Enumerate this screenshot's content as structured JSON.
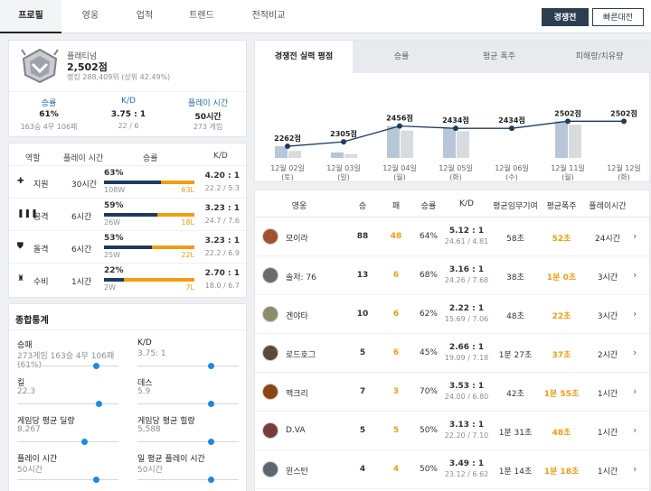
{
  "nav": {
    "tabs": [
      "프로필",
      "영웅",
      "업적",
      "트렌드",
      "전적비교"
    ],
    "modes": [
      "경쟁전",
      "빠른대전"
    ]
  },
  "tier": {
    "name": "플래티넘",
    "score": "2,502점",
    "rank": "랭킹 288,409위 (상위 42.49%)"
  },
  "summary": {
    "winrate_label": "승률",
    "winrate": "61%",
    "winrate_sub": "163승 4무 106패",
    "kd_label": "K/D",
    "kd": "3.75 : 1",
    "kd_sub": "22 / 6",
    "time_label": "플레이 시간",
    "time": "50시간",
    "time_sub": "273 게임"
  },
  "roles": {
    "headers": [
      "역할",
      "플레이 시간",
      "승률",
      "K/D"
    ],
    "rows": [
      {
        "icon": "plus-icon",
        "name": "지원",
        "time": "30시간",
        "pct": "63%",
        "w": "108W",
        "l": "63L",
        "win_frac": 0.63,
        "kd": "4.20 : 1",
        "kd_sub": "22.2 / 5.3"
      },
      {
        "icon": "damage-icon",
        "name": "공격",
        "time": "6시간",
        "pct": "59%",
        "w": "26W",
        "l": "18L",
        "win_frac": 0.59,
        "kd": "3.23 : 1",
        "kd_sub": "24.7 / 7.6"
      },
      {
        "icon": "shield-icon",
        "name": "돌격",
        "time": "6시간",
        "pct": "53%",
        "w": "25W",
        "l": "22L",
        "win_frac": 0.53,
        "kd": "3.23 : 1",
        "kd_sub": "22.2 / 6.9"
      },
      {
        "icon": "castle-icon",
        "name": "수비",
        "time": "1시간",
        "pct": "22%",
        "w": "2W",
        "l": "7L",
        "win_frac": 0.22,
        "kd": "2.70 : 1",
        "kd_sub": "18.0 / 6.7"
      }
    ]
  },
  "overall": {
    "title": "종합통계",
    "stats": [
      {
        "label": "승패",
        "value": "273게임 163승 4무 106패 (61%)",
        "level": 0.78
      },
      {
        "label": "K/D",
        "value": "3.75: 1",
        "level": 0.72
      },
      {
        "label": "킬",
        "value": "22.3",
        "level": 0.8
      },
      {
        "label": "데스",
        "value": "5.9",
        "level": 0.72
      },
      {
        "label": "게임당 평균 딜량",
        "value": "8,267",
        "level": 0.66
      },
      {
        "label": "게임당 평균 힐량",
        "value": "5,588",
        "level": 0.72
      },
      {
        "label": "플레이 시간",
        "value": "50시간",
        "level": 0.78
      },
      {
        "label": "일 평균 플레이 시간",
        "value": "50시간",
        "level": 0.72
      }
    ]
  },
  "chart_tabs": [
    "경쟁전 실력 평점",
    "승률",
    "평균 폭주",
    "피해량/치유량"
  ],
  "chart_data": {
    "type": "line",
    "categories": [
      "12월 02일\n(토)",
      "12월 03일\n(일)",
      "12월 04일\n(월)",
      "12월 05일\n(화)",
      "12월 06일\n(수)",
      "12월 11일\n(월)",
      "12월 12일\n(화)"
    ],
    "series": [
      {
        "values": [
          2262,
          2305,
          2456,
          2434,
          2434,
          2502,
          2502
        ]
      }
    ],
    "point_labels": [
      "2262점",
      "2305점",
      "2456점",
      "2434점",
      "2434점",
      "2502점",
      "2502점"
    ],
    "bars_main": [
      2262,
      2203,
      2456,
      2434,
      null,
      2502,
      null
    ],
    "bars_secondary": [
      2218,
      2188,
      2412,
      2407,
      null,
      2468,
      null
    ],
    "ylim": [
      2150,
      2600
    ],
    "grid": false
  },
  "heroes": {
    "headers": [
      "영웅",
      "승",
      "패",
      "승률",
      "K/D",
      "평균임무기여",
      "평균폭주",
      "플레이시간"
    ],
    "rows": [
      {
        "name": "모이라",
        "icon": "moira-avatar-icon",
        "color": "#a0522d",
        "w": "88",
        "l": "48",
        "rate": "64%",
        "kd": "5.12 : 1",
        "kd_sub": "24.61 / 4.81",
        "obj": "58초",
        "streak": "52초",
        "time": "24시간"
      },
      {
        "name": "솔저: 76",
        "icon": "soldier76-avatar-icon",
        "color": "#6b6b6b",
        "w": "13",
        "l": "6",
        "rate": "68%",
        "kd": "3.16 : 1",
        "kd_sub": "24.26 / 7.68",
        "obj": "38초",
        "streak": "1분 0초",
        "time": "3시간"
      },
      {
        "name": "겐야타",
        "icon": "zenyatta-avatar-icon",
        "color": "#8c8c6a",
        "w": "10",
        "l": "6",
        "rate": "62%",
        "kd": "2.22 : 1",
        "kd_sub": "15.69 / 7.06",
        "obj": "48초",
        "streak": "22초",
        "time": "3시간"
      },
      {
        "name": "로드호그",
        "icon": "roadhog-avatar-icon",
        "color": "#5a4a3a",
        "w": "5",
        "l": "6",
        "rate": "45%",
        "kd": "2.66 : 1",
        "kd_sub": "19.09 / 7.18",
        "obj": "1분 27초",
        "streak": "37초",
        "time": "2시간"
      },
      {
        "name": "맥크리",
        "icon": "mccree-avatar-icon",
        "color": "#8b4513",
        "w": "7",
        "l": "3",
        "rate": "70%",
        "kd": "3.53 : 1",
        "kd_sub": "24.00 / 6.80",
        "obj": "42초",
        "streak": "1분 55초",
        "time": "1시간"
      },
      {
        "name": "D.VA",
        "icon": "dva-avatar-icon",
        "color": "#7a3b3b",
        "w": "5",
        "l": "5",
        "rate": "50%",
        "kd": "3.13 : 1",
        "kd_sub": "22.20 / 7.10",
        "obj": "1분 31초",
        "streak": "48초",
        "time": "1시간"
      },
      {
        "name": "윈스턴",
        "icon": "winston-avatar-icon",
        "color": "#5c6670",
        "w": "4",
        "l": "4",
        "rate": "50%",
        "kd": "3.49 : 1",
        "kd_sub": "23.12 / 6.62",
        "obj": "1분 14초",
        "streak": "1분 18초",
        "time": "1시간"
      }
    ]
  },
  "colors": {
    "navy": "#1f3a5f",
    "orange": "#f39c12",
    "bar_main": "#b8c7d8",
    "bar_secondary": "#d8dbdf",
    "line": "#1f3a5f"
  }
}
